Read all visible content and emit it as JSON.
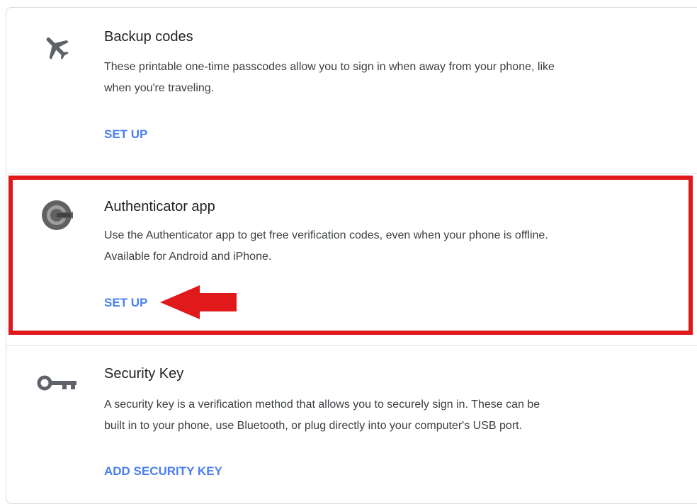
{
  "sections": [
    {
      "icon": "airplane-icon",
      "title": "Backup codes",
      "description_line1": "These printable one-time passcodes allow you to sign in when away from your phone, like",
      "description_line2": "when you're traveling.",
      "action": "SET UP"
    },
    {
      "icon": "google-authenticator-icon",
      "title": "Authenticator app",
      "description_line1": "Use the Authenticator app to get free verification codes, even when your phone is offline.",
      "description_line2": "Available for Android and iPhone.",
      "action": "SET UP"
    },
    {
      "icon": "key-icon",
      "title": "Security Key",
      "description_line1": "A security key is a verification method that allows you to securely sign in. These can be",
      "description_line2": "built in to your phone, use Bluetooth, or plug directly into your computer's USB port.",
      "action": "ADD SECURITY KEY"
    }
  ],
  "colors": {
    "link": "#4a7ff0",
    "highlight": "#e0191b",
    "arrow": "#e0191b"
  },
  "annotation": {
    "highlight_target": "Authenticator app",
    "arrow_points_to": "SET UP"
  }
}
